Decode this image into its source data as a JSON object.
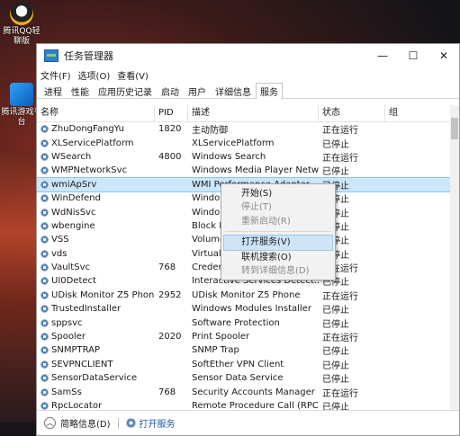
{
  "desktop": {
    "icons": [
      {
        "label": "腾讯QQ轻聊版"
      },
      {
        "label": "腾讯游戏平台"
      }
    ]
  },
  "window": {
    "title": "任务管理器",
    "controls": {
      "minimize": "—",
      "maximize": "☐",
      "close": "✕"
    }
  },
  "menu": [
    "文件(F)",
    "选项(O)",
    "查看(V)"
  ],
  "tabs": [
    "进程",
    "性能",
    "应用历史记录",
    "启动",
    "用户",
    "详细信息",
    "服务"
  ],
  "table": {
    "headers": {
      "name": "名称",
      "pid": "PID",
      "desc": "描述",
      "status": "状态",
      "group": "组"
    },
    "rows": [
      {
        "name": "ZhuDongFangYu",
        "pid": "1820",
        "desc": "主动防御",
        "status": "正在运行"
      },
      {
        "name": "XLServicePlatform",
        "pid": "",
        "desc": "XLServicePlatform",
        "status": "已停止"
      },
      {
        "name": "WSearch",
        "pid": "4800",
        "desc": "Windows Search",
        "status": "正在运行"
      },
      {
        "name": "WMPNetworkSvc",
        "pid": "",
        "desc": "Windows Media Player Netw...",
        "status": "已停止"
      },
      {
        "name": "wmiApSrv",
        "pid": "",
        "desc": "WMI Performance Adapter",
        "status": "已停止"
      },
      {
        "name": "WinDefend",
        "pid": "",
        "desc": "Windo",
        "status": "已停止"
      },
      {
        "name": "WdNisSvc",
        "pid": "",
        "desc": "Windo",
        "status": "已停止"
      },
      {
        "name": "wbengine",
        "pid": "",
        "desc": "Block L",
        "status": "已停止"
      },
      {
        "name": "VSS",
        "pid": "",
        "desc": "Volume",
        "status": "已停止"
      },
      {
        "name": "vds",
        "pid": "",
        "desc": "Virtual",
        "status": "已停止"
      },
      {
        "name": "VaultSvc",
        "pid": "768",
        "desc": "Creden",
        "status": "正在运行"
      },
      {
        "name": "UI0Detect",
        "pid": "",
        "desc": "Interactive Services Detect...",
        "status": "已停止"
      },
      {
        "name": "UDisk Monitor Z5 Phone",
        "pid": "2952",
        "desc": "UDisk Monitor Z5 Phone",
        "status": "正在运行"
      },
      {
        "name": "TrustedInstaller",
        "pid": "",
        "desc": "Windows Modules Installer",
        "status": "已停止"
      },
      {
        "name": "sppsvc",
        "pid": "",
        "desc": "Software Protection",
        "status": "已停止"
      },
      {
        "name": "Spooler",
        "pid": "2020",
        "desc": "Print Spooler",
        "status": "正在运行"
      },
      {
        "name": "SNMPTRAP",
        "pid": "",
        "desc": "SNMP Trap",
        "status": "已停止"
      },
      {
        "name": "SEVPNCLIENT",
        "pid": "",
        "desc": "SoftEther VPN Client",
        "status": "已停止"
      },
      {
        "name": "SensorDataService",
        "pid": "",
        "desc": "Sensor Data Service",
        "status": "已停止"
      },
      {
        "name": "SamSs",
        "pid": "768",
        "desc": "Security Accounts Manager",
        "status": "正在运行"
      },
      {
        "name": "RpcLocator",
        "pid": "",
        "desc": "Remote Procedure Call (RPC)...",
        "status": "已停止"
      }
    ]
  },
  "context_menu": [
    {
      "label": "开始(S)",
      "enabled": true
    },
    {
      "label": "停止(T)",
      "enabled": false
    },
    {
      "label": "重新启动(R)",
      "enabled": false
    },
    {
      "separator": true
    },
    {
      "label": "打开服务(V)",
      "enabled": true,
      "highlighted": true
    },
    {
      "label": "联机搜索(O)",
      "enabled": true
    },
    {
      "label": "转到详细信息(D)",
      "enabled": false
    }
  ],
  "statusbar": {
    "brief": "简略信息(D)",
    "open_services": "打开服务"
  },
  "colors": {
    "selection": "#cce6fb",
    "link": "#1a57a8"
  }
}
